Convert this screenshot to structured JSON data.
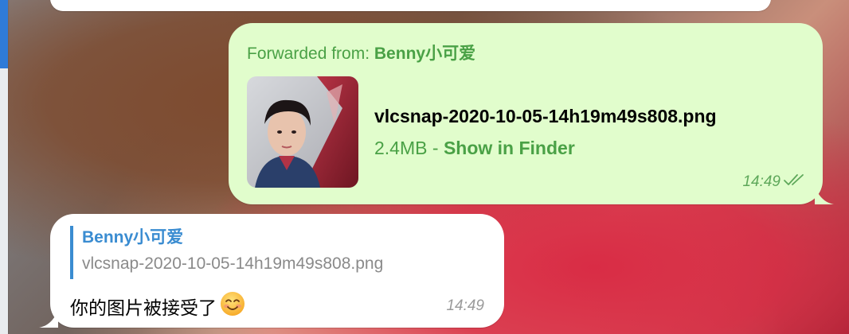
{
  "forwarded_message": {
    "forward_prefix": "Forwarded from: ",
    "forward_sender": "Benny小可爱",
    "file_name": "vlcsnap-2020-10-05-14h19m49s808.png",
    "file_size": "2.4MB",
    "separator": " - ",
    "finder_link_label": "Show in Finder",
    "time": "14:49",
    "status_icon": "double-check-icon",
    "bubble_color": "#e1fdcc",
    "accent_color": "#4aa146"
  },
  "reply_message": {
    "reply_to_name": "Benny小可爱",
    "reply_to_text": "vlcsnap-2020-10-05-14h19m49s808.png",
    "text": "你的图片被接受了",
    "emoji": "😊",
    "time": "14:49",
    "name_color": "#3a8cd1"
  }
}
